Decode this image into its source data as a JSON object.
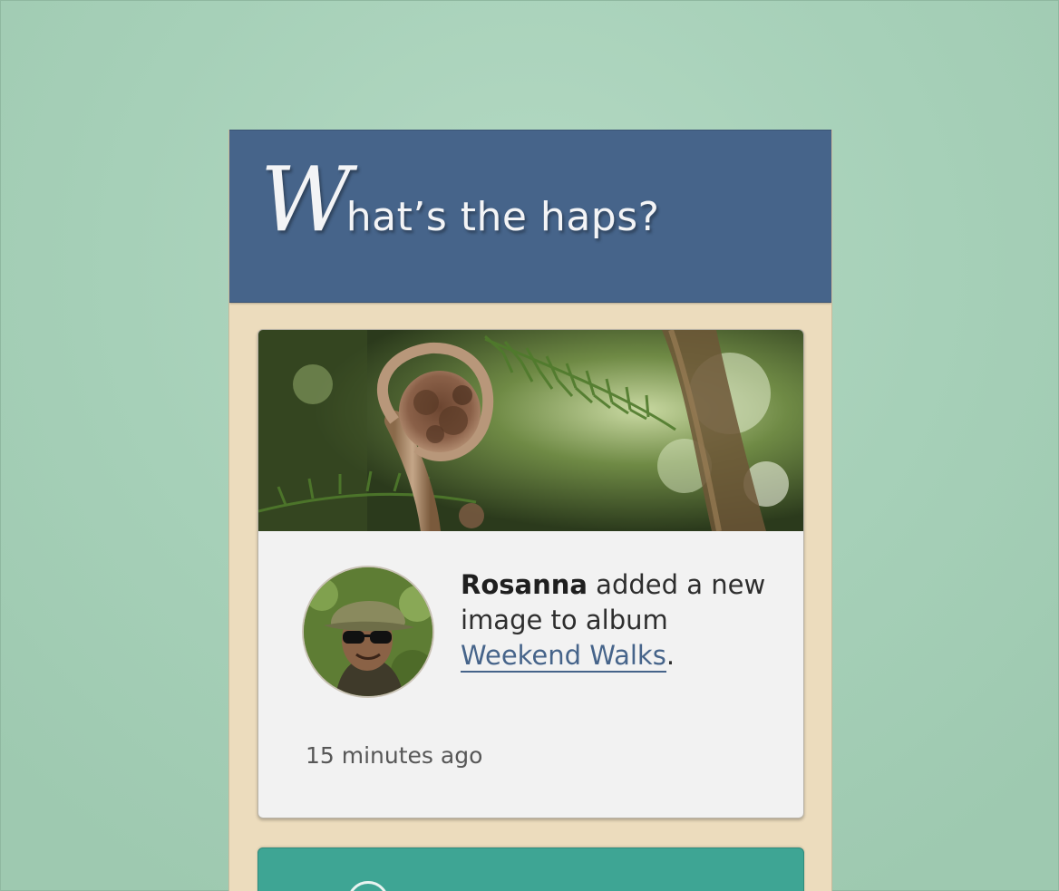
{
  "header": {
    "title_initial": "W",
    "title_rest": "hat’s the haps?"
  },
  "feed": {
    "items": [
      {
        "image_alt": "Fern frond unfurling",
        "author": "Rosanna",
        "action_text": " added a new image to album ",
        "album": "Weekend Walks",
        "trailing": ".",
        "time": "15 minutes ago"
      }
    ]
  },
  "colors": {
    "background": "#a6d0b8",
    "header": "#46648a",
    "panel": "#ecdcbd",
    "card": "#f2f2f2",
    "link": "#46648a",
    "next_card": "#3ea594"
  },
  "icons": [
    "fern-photo",
    "user-avatar-photo"
  ]
}
